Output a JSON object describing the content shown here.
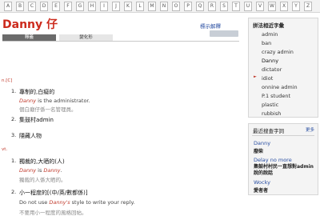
{
  "alphabet": [
    "A",
    "B",
    "C",
    "D",
    "E",
    "F",
    "G",
    "H",
    "I",
    "J",
    "K",
    "L",
    "M",
    "N",
    "O",
    "P",
    "Q",
    "R",
    "S",
    "T",
    "U",
    "V",
    "W",
    "X",
    "Y",
    "Z"
  ],
  "word": "Danny 仔",
  "header_link": "標示解釋",
  "tabs": [
    "釋義",
    "變化形"
  ],
  "sections": [
    {
      "pos": "n.[C]",
      "entries": [
        {
          "num": "1.",
          "definition": "專制的,白癡的",
          "example_word": "Danny",
          "example_rest": " is the administrator.",
          "zh": "個白癡仔係一名管理員。"
        },
        {
          "num": "2.",
          "definition": "集鼓村admin"
        },
        {
          "num": "3.",
          "definition": "隱藏人物"
        }
      ]
    },
    {
      "pos": "vt.",
      "entries": [
        {
          "num": "1.",
          "definition": "獨裁的,大晒的(人)",
          "example_word": "Danny",
          "example_mid": " is ",
          "example_word2": "Danny",
          "example_end": ".",
          "zh": "獨裁的人係大晒的。"
        },
        {
          "num": "2.",
          "definition": "小一程度的[(中/英/數都係)]",
          "example_pre": "Do not use ",
          "example_word": "Danny's",
          "example_rest": " style to write your reply.",
          "zh": "不要用小一程度的風格回帖。"
        }
      ]
    }
  ],
  "related": {
    "title": "拼法相近字彙",
    "items": [
      "admin",
      "ban",
      "crazy admin",
      "Danny",
      "dictator",
      "idiot",
      "onnine admin",
      "P.1 student",
      "plastic",
      "rubbish"
    ],
    "current": "Danny"
  },
  "recent": {
    "title": "最近搜查字詞",
    "more": "更多",
    "entries": [
      {
        "word": "Danny",
        "meaning": "廢柴"
      },
      {
        "word": "Delay no more",
        "meaning": "集鼓村村民一直想對admin說的說話"
      },
      {
        "word": "Wocky",
        "meaning": "愛者者"
      }
    ]
  }
}
